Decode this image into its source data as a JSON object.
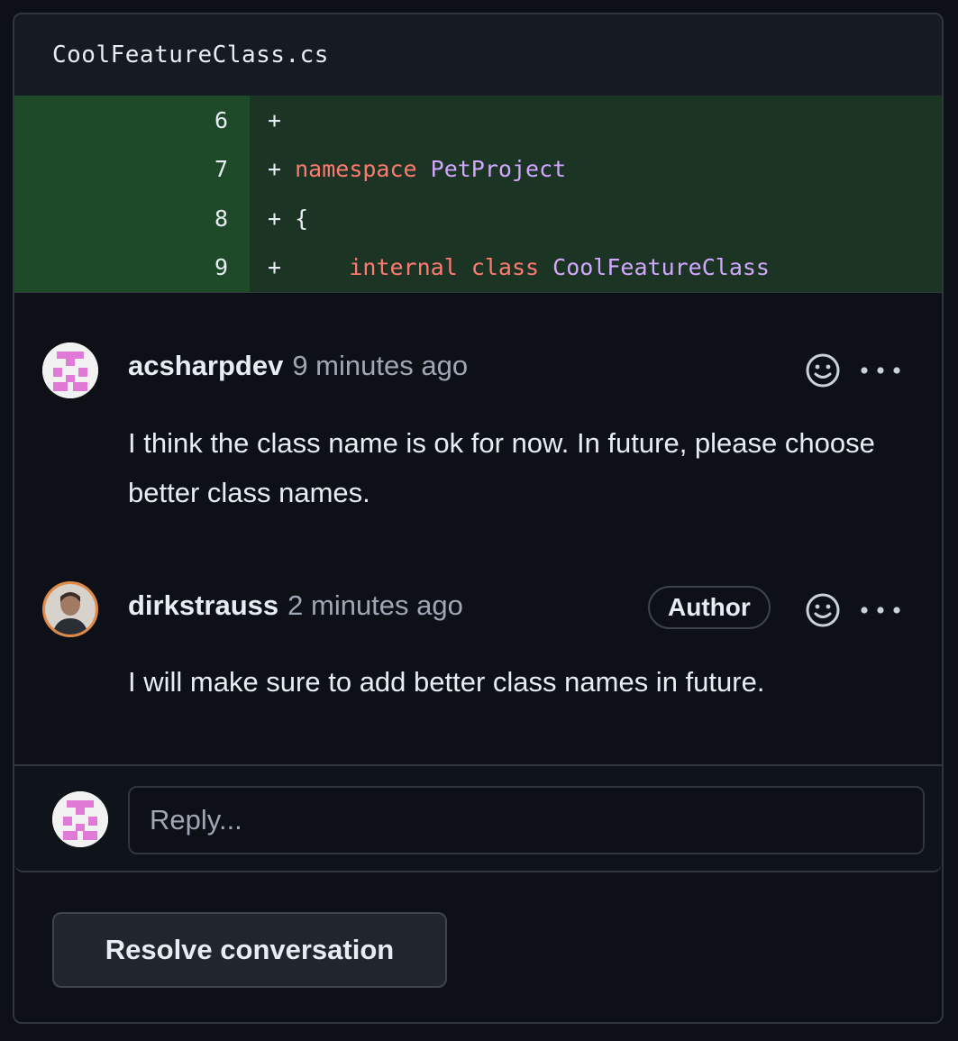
{
  "file": {
    "name": "CoolFeatureClass.cs"
  },
  "diff": {
    "lines": [
      {
        "num": "6",
        "sign": "+",
        "tokens": []
      },
      {
        "num": "7",
        "sign": "+",
        "tokens": [
          {
            "t": "namespace",
            "c": "kw"
          },
          {
            "t": " "
          },
          {
            "t": "PetProject",
            "c": "nm"
          }
        ]
      },
      {
        "num": "8",
        "sign": "+",
        "tokens": [
          {
            "t": "{"
          }
        ]
      },
      {
        "num": "9",
        "sign": "+",
        "tokens": [
          {
            "t": "    "
          },
          {
            "t": "internal",
            "c": "kw"
          },
          {
            "t": " "
          },
          {
            "t": "class",
            "c": "kw"
          },
          {
            "t": " "
          },
          {
            "t": "CoolFeatureClass",
            "c": "nm"
          }
        ]
      }
    ]
  },
  "comments": [
    {
      "author": "acsharpdev",
      "time": "9 minutes ago",
      "body": "I think the class name is ok for now. In future, please choose better class names.",
      "avatar": "identicon-avatar",
      "badge": ""
    },
    {
      "author": "dirkstrauss",
      "time": "2 minutes ago",
      "body": "I will make sure to add better class names in future.",
      "avatar": "photo-avatar",
      "badge": "Author"
    }
  ],
  "reply": {
    "placeholder": "Reply..."
  },
  "actions": {
    "resolve_label": "Resolve conversation"
  },
  "icons": {
    "reaction": "smiley-icon",
    "more": "kebab-icon"
  },
  "colors": {
    "keyword": "#ff7b72",
    "name": "#d2a8ff",
    "added_bg": "#1b3424",
    "page_bg": "#0d1117"
  }
}
